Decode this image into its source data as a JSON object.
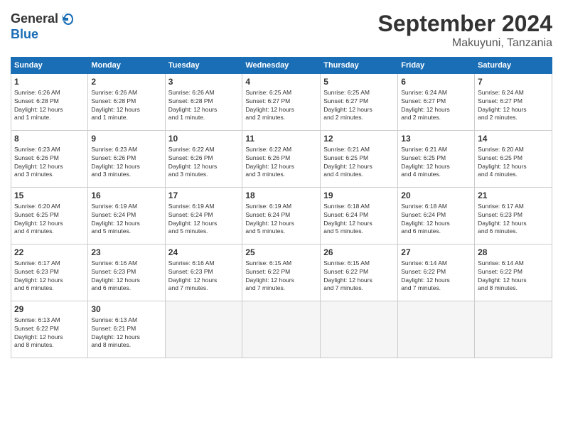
{
  "logo": {
    "general": "General",
    "blue": "Blue"
  },
  "header": {
    "month": "September 2024",
    "location": "Makuyuni, Tanzania"
  },
  "weekdays": [
    "Sunday",
    "Monday",
    "Tuesday",
    "Wednesday",
    "Thursday",
    "Friday",
    "Saturday"
  ],
  "weeks": [
    [
      {
        "day": "1",
        "info": "Sunrise: 6:26 AM\nSunset: 6:28 PM\nDaylight: 12 hours\nand 1 minute."
      },
      {
        "day": "2",
        "info": "Sunrise: 6:26 AM\nSunset: 6:28 PM\nDaylight: 12 hours\nand 1 minute."
      },
      {
        "day": "3",
        "info": "Sunrise: 6:26 AM\nSunset: 6:28 PM\nDaylight: 12 hours\nand 1 minute."
      },
      {
        "day": "4",
        "info": "Sunrise: 6:25 AM\nSunset: 6:27 PM\nDaylight: 12 hours\nand 2 minutes."
      },
      {
        "day": "5",
        "info": "Sunrise: 6:25 AM\nSunset: 6:27 PM\nDaylight: 12 hours\nand 2 minutes."
      },
      {
        "day": "6",
        "info": "Sunrise: 6:24 AM\nSunset: 6:27 PM\nDaylight: 12 hours\nand 2 minutes."
      },
      {
        "day": "7",
        "info": "Sunrise: 6:24 AM\nSunset: 6:27 PM\nDaylight: 12 hours\nand 2 minutes."
      }
    ],
    [
      {
        "day": "8",
        "info": "Sunrise: 6:23 AM\nSunset: 6:26 PM\nDaylight: 12 hours\nand 3 minutes."
      },
      {
        "day": "9",
        "info": "Sunrise: 6:23 AM\nSunset: 6:26 PM\nDaylight: 12 hours\nand 3 minutes."
      },
      {
        "day": "10",
        "info": "Sunrise: 6:22 AM\nSunset: 6:26 PM\nDaylight: 12 hours\nand 3 minutes."
      },
      {
        "day": "11",
        "info": "Sunrise: 6:22 AM\nSunset: 6:26 PM\nDaylight: 12 hours\nand 3 minutes."
      },
      {
        "day": "12",
        "info": "Sunrise: 6:21 AM\nSunset: 6:25 PM\nDaylight: 12 hours\nand 4 minutes."
      },
      {
        "day": "13",
        "info": "Sunrise: 6:21 AM\nSunset: 6:25 PM\nDaylight: 12 hours\nand 4 minutes."
      },
      {
        "day": "14",
        "info": "Sunrise: 6:20 AM\nSunset: 6:25 PM\nDaylight: 12 hours\nand 4 minutes."
      }
    ],
    [
      {
        "day": "15",
        "info": "Sunrise: 6:20 AM\nSunset: 6:25 PM\nDaylight: 12 hours\nand 4 minutes."
      },
      {
        "day": "16",
        "info": "Sunrise: 6:19 AM\nSunset: 6:24 PM\nDaylight: 12 hours\nand 5 minutes."
      },
      {
        "day": "17",
        "info": "Sunrise: 6:19 AM\nSunset: 6:24 PM\nDaylight: 12 hours\nand 5 minutes."
      },
      {
        "day": "18",
        "info": "Sunrise: 6:19 AM\nSunset: 6:24 PM\nDaylight: 12 hours\nand 5 minutes."
      },
      {
        "day": "19",
        "info": "Sunrise: 6:18 AM\nSunset: 6:24 PM\nDaylight: 12 hours\nand 5 minutes."
      },
      {
        "day": "20",
        "info": "Sunrise: 6:18 AM\nSunset: 6:24 PM\nDaylight: 12 hours\nand 6 minutes."
      },
      {
        "day": "21",
        "info": "Sunrise: 6:17 AM\nSunset: 6:23 PM\nDaylight: 12 hours\nand 6 minutes."
      }
    ],
    [
      {
        "day": "22",
        "info": "Sunrise: 6:17 AM\nSunset: 6:23 PM\nDaylight: 12 hours\nand 6 minutes."
      },
      {
        "day": "23",
        "info": "Sunrise: 6:16 AM\nSunset: 6:23 PM\nDaylight: 12 hours\nand 6 minutes."
      },
      {
        "day": "24",
        "info": "Sunrise: 6:16 AM\nSunset: 6:23 PM\nDaylight: 12 hours\nand 7 minutes."
      },
      {
        "day": "25",
        "info": "Sunrise: 6:15 AM\nSunset: 6:22 PM\nDaylight: 12 hours\nand 7 minutes."
      },
      {
        "day": "26",
        "info": "Sunrise: 6:15 AM\nSunset: 6:22 PM\nDaylight: 12 hours\nand 7 minutes."
      },
      {
        "day": "27",
        "info": "Sunrise: 6:14 AM\nSunset: 6:22 PM\nDaylight: 12 hours\nand 7 minutes."
      },
      {
        "day": "28",
        "info": "Sunrise: 6:14 AM\nSunset: 6:22 PM\nDaylight: 12 hours\nand 8 minutes."
      }
    ],
    [
      {
        "day": "29",
        "info": "Sunrise: 6:13 AM\nSunset: 6:22 PM\nDaylight: 12 hours\nand 8 minutes."
      },
      {
        "day": "30",
        "info": "Sunrise: 6:13 AM\nSunset: 6:21 PM\nDaylight: 12 hours\nand 8 minutes."
      },
      {
        "day": "",
        "info": ""
      },
      {
        "day": "",
        "info": ""
      },
      {
        "day": "",
        "info": ""
      },
      {
        "day": "",
        "info": ""
      },
      {
        "day": "",
        "info": ""
      }
    ]
  ]
}
